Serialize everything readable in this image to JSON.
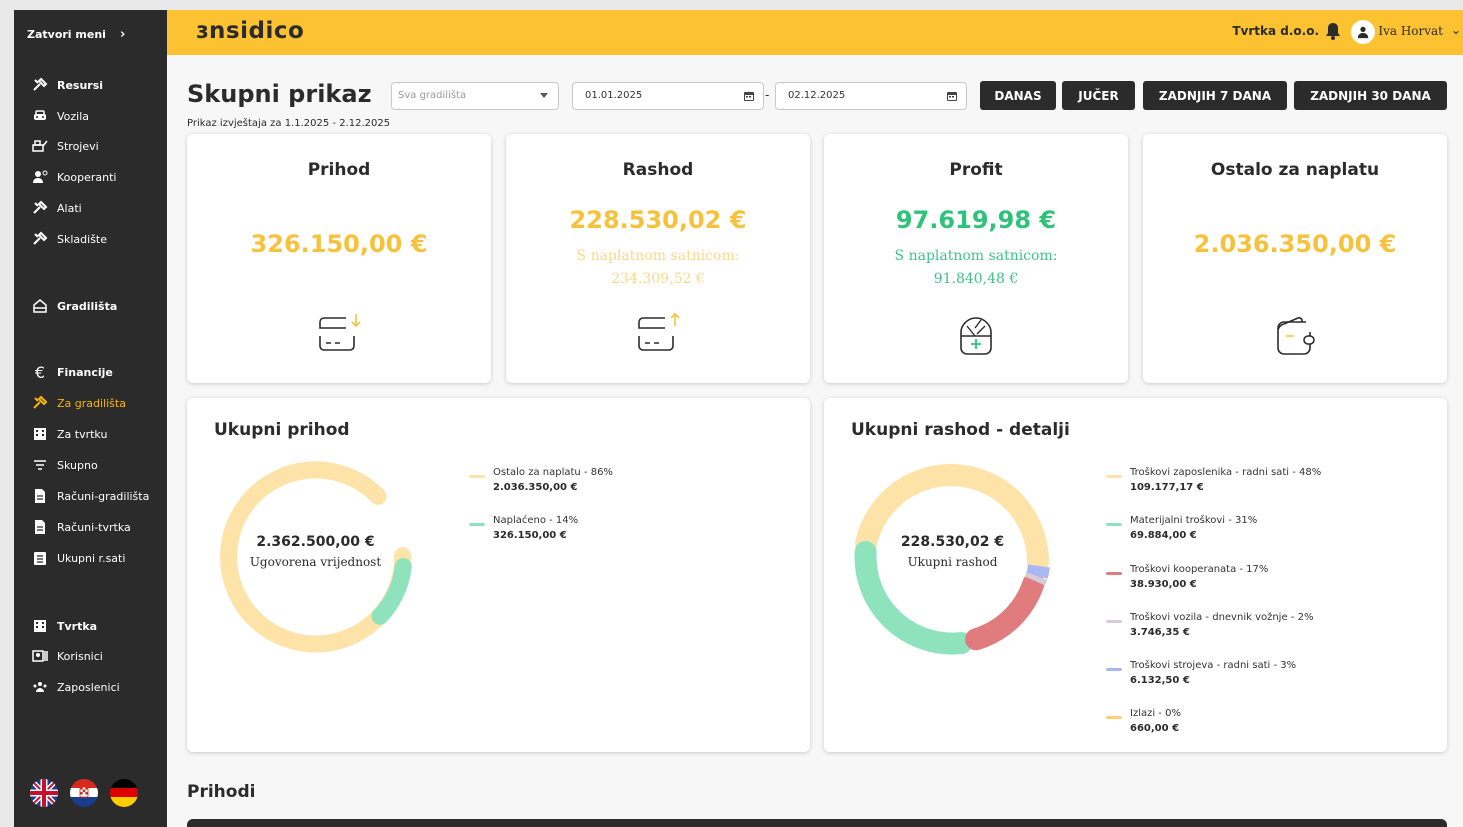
{
  "sidebar": {
    "toggle_label": "Zatvori meni",
    "toggle_icon": "chevron-right-icon",
    "items": [
      {
        "label": "Resursi",
        "icon": "tools-icon",
        "head": true
      },
      {
        "label": "Vozila",
        "icon": "car-icon"
      },
      {
        "label": "Strojevi",
        "icon": "machine-icon"
      },
      {
        "label": "Kooperanti",
        "icon": "partners-icon"
      },
      {
        "label": "Alati",
        "icon": "tools-icon"
      },
      {
        "label": "Skladište",
        "icon": "tools-icon"
      },
      {
        "label": "Gradilišta",
        "icon": "site-icon",
        "head": true
      },
      {
        "label": "Financije",
        "icon": "euro-icon",
        "head": true
      },
      {
        "label": "Za gradilišta",
        "icon": "tools-icon",
        "active": true
      },
      {
        "label": "Za tvrtku",
        "icon": "building-icon"
      },
      {
        "label": "Skupno",
        "icon": "filter-icon"
      },
      {
        "label": "Računi-gradilišta",
        "icon": "document-icon"
      },
      {
        "label": "Računi-tvrtka",
        "icon": "document-icon"
      },
      {
        "label": "Ukupni r.sati",
        "icon": "list-icon"
      },
      {
        "label": "Tvrtka",
        "icon": "building-icon",
        "head": true
      },
      {
        "label": "Korisnici",
        "icon": "users-card-icon"
      },
      {
        "label": "Zaposlenici",
        "icon": "team-icon"
      }
    ],
    "flags": [
      "uk-flag-icon",
      "croatia-flag-icon",
      "germany-flag-icon"
    ]
  },
  "topbar": {
    "logo": "ɜnsidico",
    "company": "Tvrtka d.o.o.",
    "user_name": "Iva Horvat",
    "accent": "#fcc232"
  },
  "header": {
    "title": "Skupni prikaz",
    "subtitle": "Prikaz izvještaja za 1.1.2025 - 2.12.2025",
    "site_select_placeholder": "Sva gradilišta",
    "date_from": "01.01.2025",
    "date_separator": "-",
    "date_to": "02.12.2025",
    "quick_buttons": [
      "DANAS",
      "JUČER",
      "ZADNJIH 7 DANA",
      "ZADNJIH 30 DANA"
    ]
  },
  "kpis": [
    {
      "title": "Prihod",
      "value": "326.150,00 €",
      "icon": "card-income-icon"
    },
    {
      "title": "Rashod",
      "value": "228.530,02 €",
      "sub_label": "S naplatnom satnicom:",
      "sub_value": "234.309,52 €",
      "icon": "card-expense-icon"
    },
    {
      "title": "Profit",
      "value": "97.619,98 €",
      "sub_label": "S naplatnom satnicom:",
      "sub_value": "91.840,48 €",
      "icon": "money-bag-icon"
    },
    {
      "title": "Ostalo za naplatu",
      "value": "2.036.350,00 €",
      "icon": "wallet-icon"
    }
  ],
  "income_chart": {
    "title": "Ukupni prihod",
    "center_value": "2.362.500,00 €",
    "center_label": "Ugovorena vrijednost",
    "legend": [
      {
        "label": "Ostalo za naplatu - 86%",
        "value": "2.036.350,00 €",
        "color": "#fde3a7"
      },
      {
        "label": "Naplaćeno - 14%",
        "value": "326.150,00 €",
        "color": "#8ee3bd"
      }
    ]
  },
  "expense_chart": {
    "title": "Ukupni rashod - detalji",
    "center_value": "228.530,02 €",
    "center_label": "Ukupni rashod",
    "legend": [
      {
        "label": "Troškovi zaposlenika - radni sati - 48%",
        "value": "109.177,17 €",
        "color": "#fde3a7"
      },
      {
        "label": "Materijalni troškovi - 31%",
        "value": "69.884,00 €",
        "color": "#8ee3bd"
      },
      {
        "label": "Troškovi kooperanata - 17%",
        "value": "38.930,00 €",
        "color": "#e07b7e"
      },
      {
        "label": "Troškovi vozila - dnevnik vožnje - 2%",
        "value": "3.746,35 €",
        "color": "#d6ccd8"
      },
      {
        "label": "Troškovi strojeva - radni sati - 3%",
        "value": "6.132,50 €",
        "color": "#a9b8f0"
      },
      {
        "label": "Izlazi - 0%",
        "value": "660,00 €",
        "color": "#f9cf7a"
      }
    ]
  },
  "section": {
    "title": "Prihodi"
  }
}
